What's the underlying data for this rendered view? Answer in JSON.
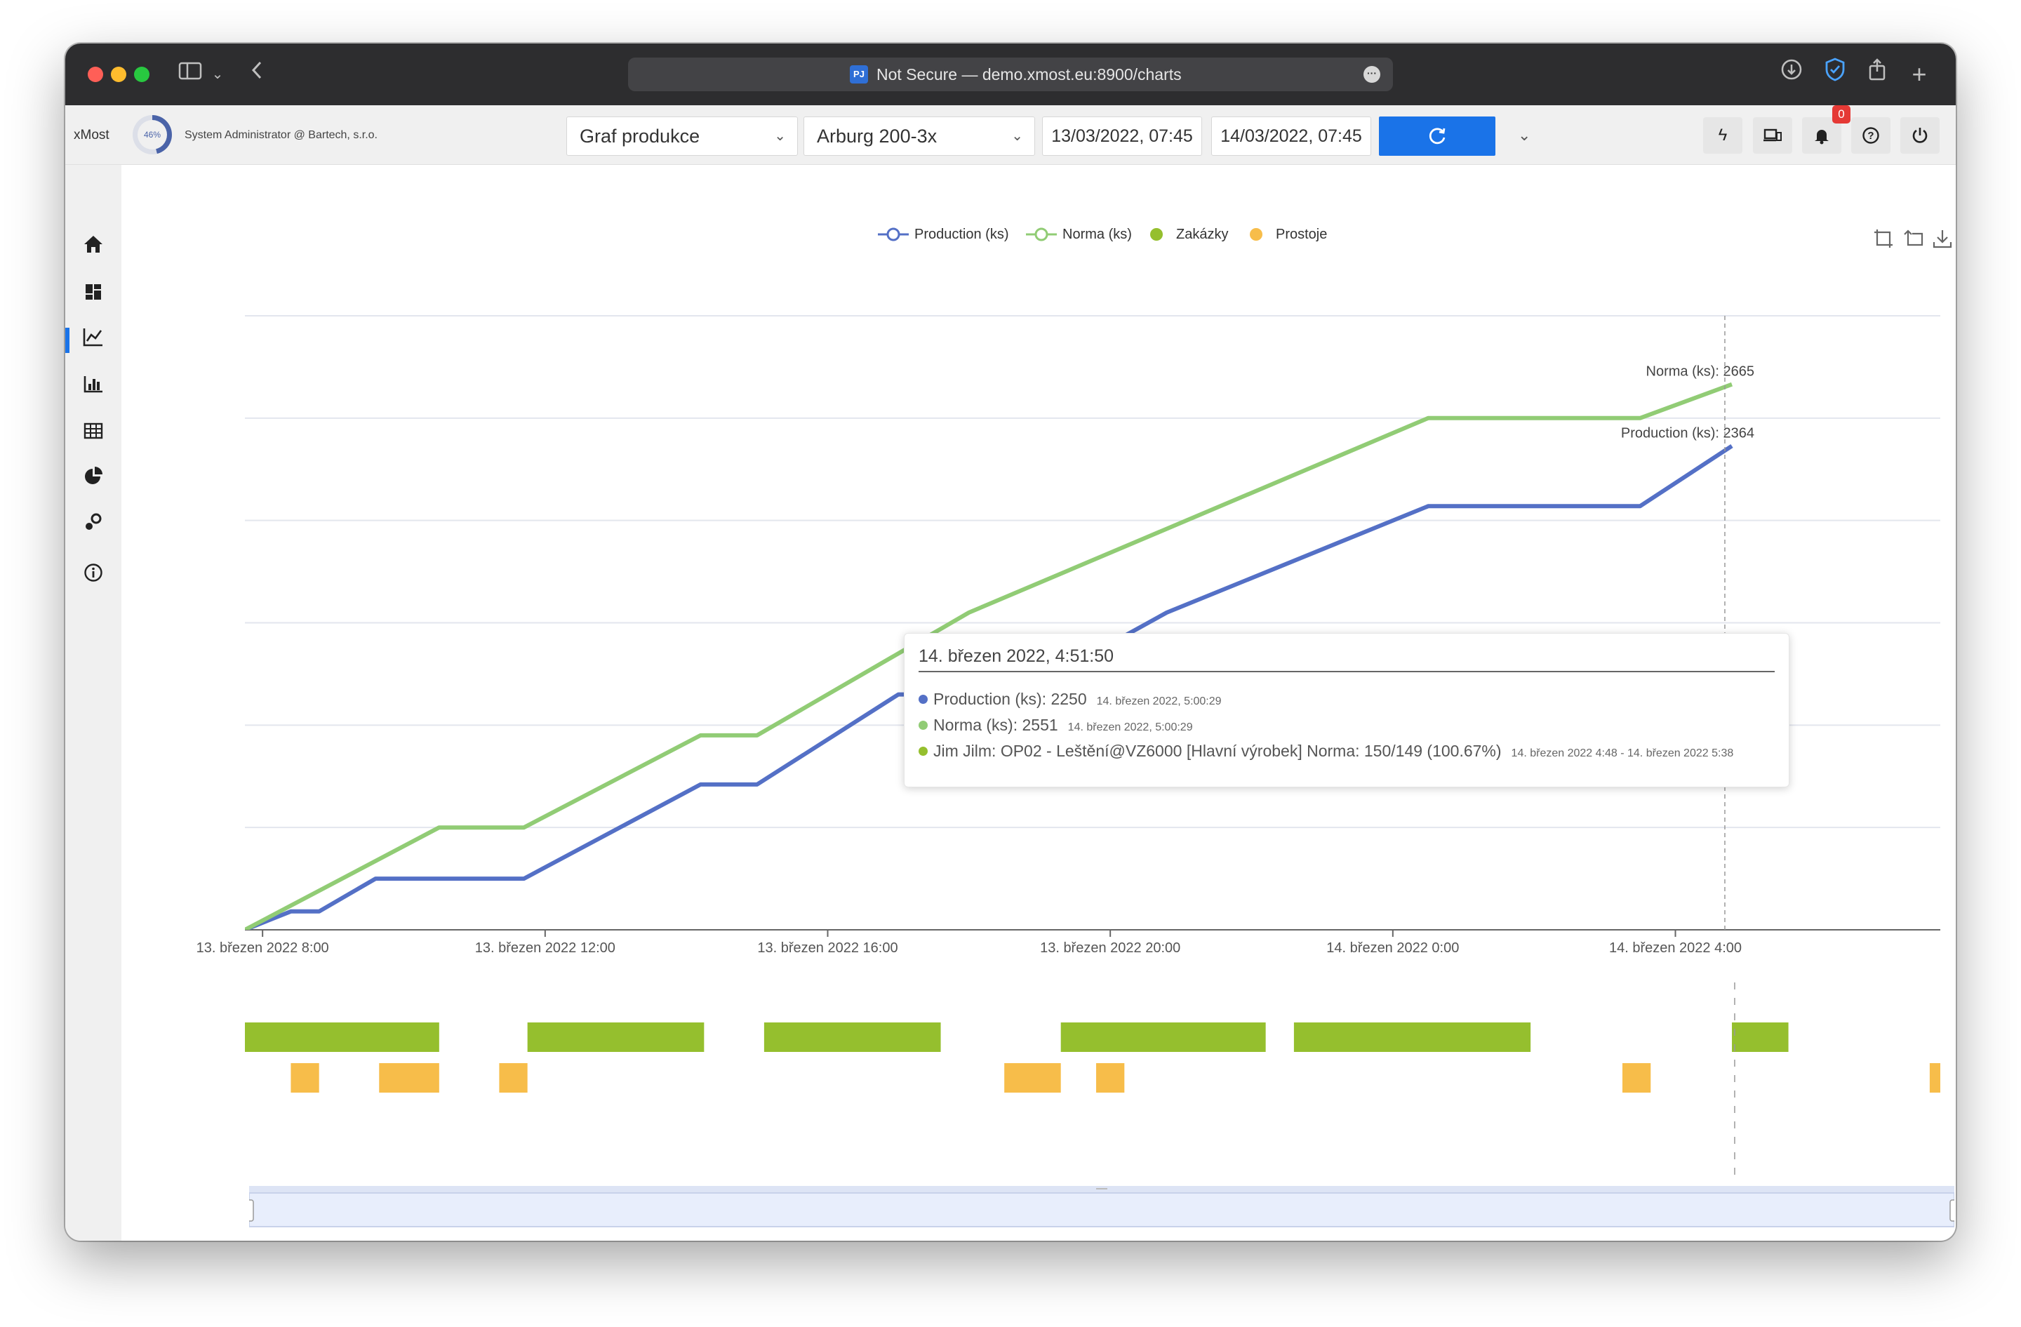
{
  "browser": {
    "url_text": "Not Secure — demo.xmost.eu:8900/charts",
    "site_badge": "PJ"
  },
  "app": {
    "brand": "xMost",
    "gauge_label": "46%",
    "gauge_value": 0.46,
    "user": "System Administrator @ Bartech, s.r.o.",
    "chart_type_select": "Graf produkce",
    "machine_select": "Arburg 200-3x",
    "date_from": "13/03/2022, 07:45",
    "date_to": "14/03/2022, 07:45",
    "notification_count": "0",
    "accent_color": "#1a73e8"
  },
  "sidebar": {
    "items": [
      {
        "icon": "home-icon",
        "active": false
      },
      {
        "icon": "dashboard-icon",
        "active": false
      },
      {
        "icon": "line-chart-icon",
        "active": true
      },
      {
        "icon": "bar-chart-icon",
        "active": false
      },
      {
        "icon": "table-icon",
        "active": false
      },
      {
        "icon": "pie-chart-icon",
        "active": false
      },
      {
        "icon": "settings-icon",
        "active": false
      },
      {
        "icon": "info-icon",
        "active": false
      }
    ]
  },
  "chart_data": {
    "type": "line",
    "legend": [
      "Production (ks)",
      "Norma (ks)",
      "Zakázky",
      "Prostoje"
    ],
    "colors": {
      "production": "#5470c6",
      "norma": "#91cc75",
      "zakazky": "#95bf2e",
      "prostoje": "#f7bd4a"
    },
    "x_ticks": [
      "13. březen 2022 8:00",
      "13. březen 2022 12:00",
      "13. březen 2022 16:00",
      "13. březen 2022 20:00",
      "14. březen 2022 0:00",
      "14. březen 2022 4:00"
    ],
    "x_tick_hours": [
      8,
      12,
      16,
      20,
      24,
      28
    ],
    "x_range_hours": [
      7.75,
      31.75
    ],
    "ylim": [
      0,
      3000
    ],
    "series": [
      {
        "name": "Production (ks)",
        "x": [
          7.75,
          8.4,
          8.8,
          9.6,
          11.7,
          14.2,
          15.0,
          17.0,
          18.7,
          20.8,
          24.5,
          27.5,
          28.8
        ],
        "y": [
          0,
          90,
          90,
          250,
          250,
          710,
          710,
          1150,
          1150,
          1550,
          2070,
          2070,
          2364
        ]
      },
      {
        "name": "Norma (ks)",
        "x": [
          7.75,
          10.5,
          11.7,
          14.2,
          15.0,
          18.0,
          24.5,
          27.5,
          28.8
        ],
        "y": [
          0,
          500,
          500,
          950,
          950,
          1550,
          2500,
          2500,
          2665
        ]
      }
    ],
    "end_labels": [
      "Norma (ks): 2665",
      "Production (ks): 2364"
    ],
    "zakazky": [
      [
        7.75,
        10.5
      ],
      [
        11.75,
        14.25
      ],
      [
        15.1,
        17.6
      ],
      [
        19.3,
        22.2
      ],
      [
        22.6,
        25.95
      ],
      [
        28.8,
        29.6
      ]
    ],
    "prostoje": [
      [
        8.4,
        8.8
      ],
      [
        9.65,
        10.5
      ],
      [
        11.35,
        11.75
      ],
      [
        18.5,
        19.3
      ],
      [
        19.8,
        20.2
      ],
      [
        27.25,
        27.65
      ],
      [
        31.6,
        31.75
      ]
    ],
    "cursor_hour": 28.7
  },
  "tooltip": {
    "title": "14. březen 2022, 4:51:50",
    "rows": [
      {
        "text": "Production (ks): 2250",
        "time": "14. březen 2022, 5:00:29",
        "color": "#5470c6"
      },
      {
        "text": "Norma (ks): 2551",
        "time": "14. březen 2022, 5:00:29",
        "color": "#91cc75"
      },
      {
        "text": "Jim Jilm: OP02 - Leštění@VZ6000 [Hlavní výrobek] Norma: 150/149 (100.67%)",
        "time": "14. březen 2022 4:48 - 14. březen 2022 5:38",
        "color": "#95bf2e"
      }
    ]
  }
}
